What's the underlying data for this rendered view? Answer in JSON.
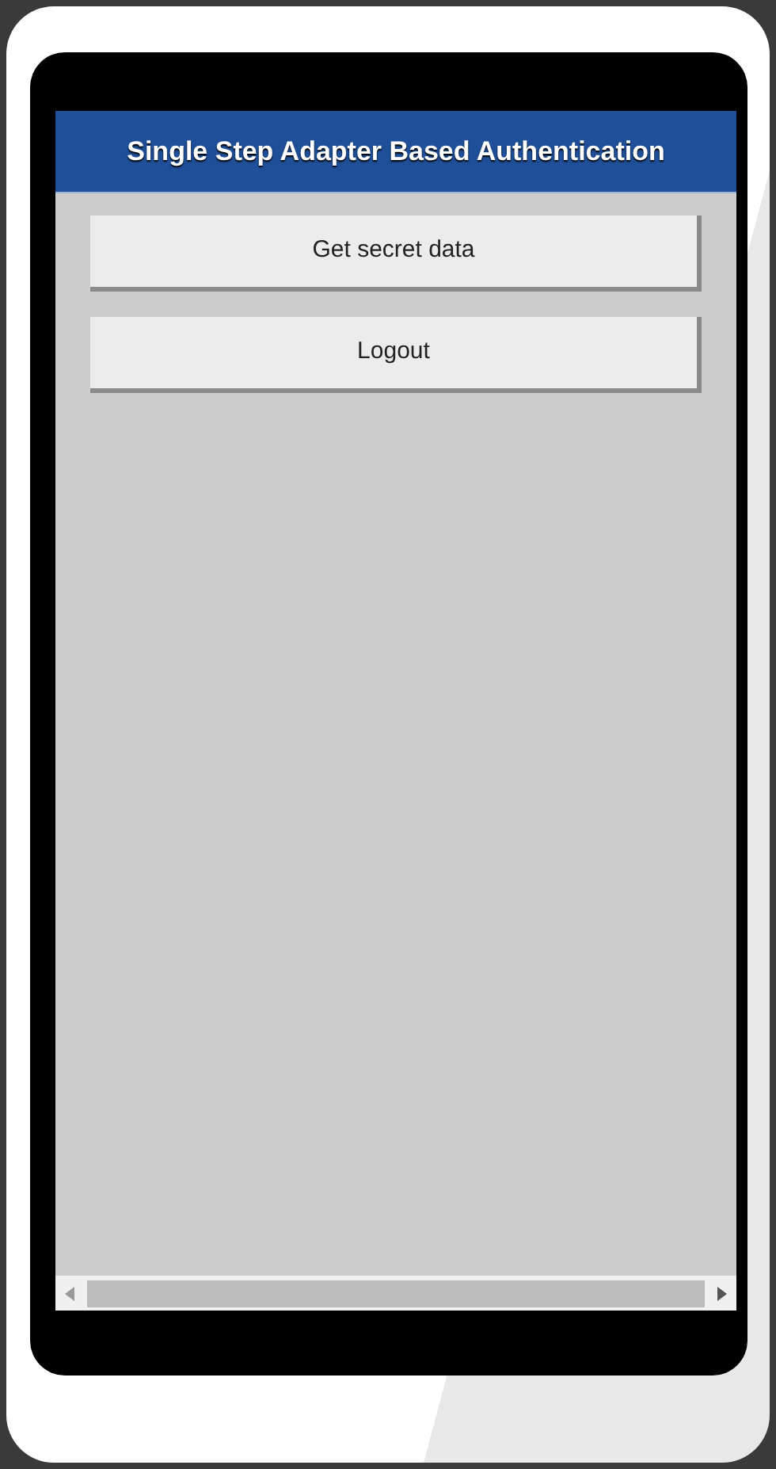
{
  "header": {
    "title": "Single Step Adapter Based Authentication"
  },
  "buttons": [
    {
      "label": "Get secret data"
    },
    {
      "label": "Logout"
    }
  ]
}
